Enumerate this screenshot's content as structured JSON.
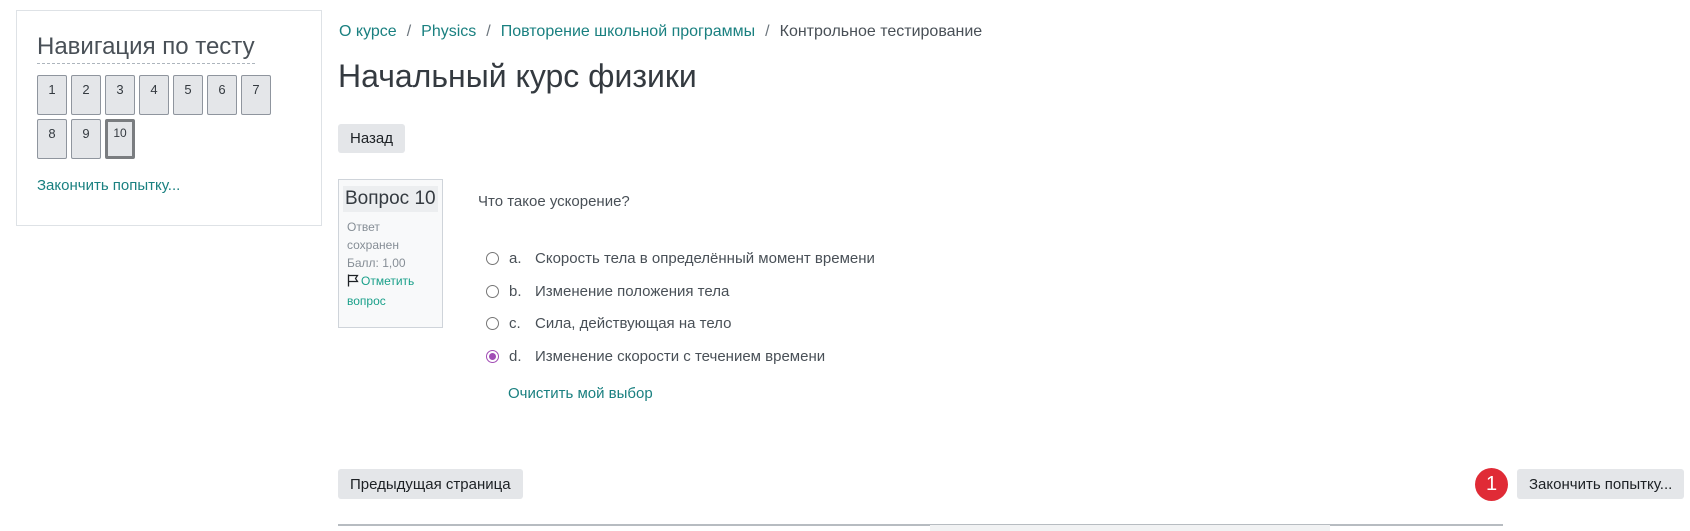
{
  "nav": {
    "title": "Навигация по тесту",
    "questions": [
      "1",
      "2",
      "3",
      "4",
      "5",
      "6",
      "7",
      "8",
      "9",
      "10"
    ],
    "current": "10",
    "finish_link": "Закончить попытку..."
  },
  "breadcrumb": {
    "items": [
      "О курсе",
      "Physics",
      "Повторение школьной программы"
    ],
    "current": "Контрольное тестирование"
  },
  "page_title": "Начальный курс физики",
  "back_button": "Назад",
  "question_info": {
    "label": "Вопрос 10",
    "status": [
      "Ответ",
      "сохранен"
    ],
    "score": "Балл: 1,00",
    "flag": [
      "Отметить",
      "вопрос"
    ]
  },
  "question_text": "Что такое ускорение?",
  "answers": [
    {
      "letter": "a.",
      "text": "Скорость тела в определённый момент времени",
      "checked": false
    },
    {
      "letter": "b.",
      "text": "Изменение положения тела",
      "checked": false
    },
    {
      "letter": "c.",
      "text": "Сила, действующая на тело",
      "checked": false
    },
    {
      "letter": "d.",
      "text": "Изменение скорости с течением времени",
      "checked": true
    }
  ],
  "clear_choice": "Очистить мой выбор",
  "prev_page_button": "Предыдущая страница",
  "finish_button": "Закончить попытку...",
  "badge": "1",
  "colors": {
    "accent": "#1a8080",
    "radio_checked": "#a14cb5",
    "badge": "#e02b36"
  }
}
